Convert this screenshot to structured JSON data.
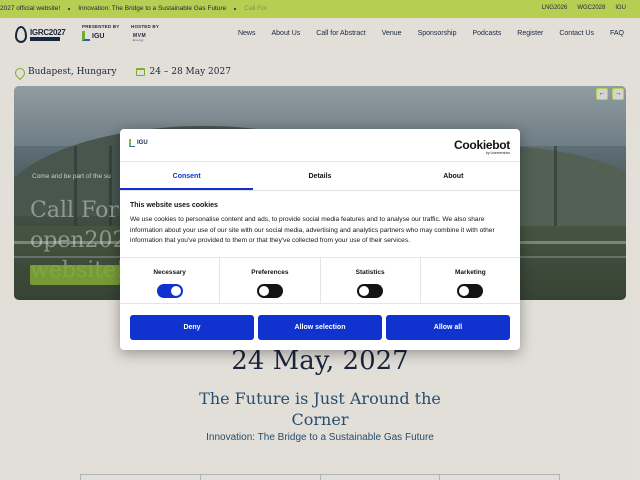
{
  "ticker": {
    "items": [
      "2027 official website!",
      "Innovation: The Bridge to a Sustainable Gas Future",
      "Call For"
    ],
    "sister_links": [
      "LNG2026",
      "WGC2028",
      "IGU"
    ]
  },
  "header": {
    "logo_text": "IGRC2027",
    "presented_by": "PRESENTED BY",
    "igu_logo": "IGU",
    "hosted_by": "HOSTED BY",
    "mvm_logo": "MVM",
    "mvm_sub": "Energy",
    "nav": [
      "News",
      "About Us",
      "Call for Abstract",
      "Venue",
      "Sponsorship",
      "Podcasts",
      "Register",
      "Contact Us",
      "FAQ"
    ]
  },
  "event": {
    "location": "Budapest, Hungary",
    "dates": "24 – 28 May 2027"
  },
  "hero": {
    "subtitle": "Come and be part of the su",
    "title": "Call For A open202 website!"
  },
  "main": {
    "date_big": "24 May, 2027",
    "future_heading": "The Future is Just Around the Corner",
    "tagline": "Innovation: The Bridge to a Sustainable Gas Future"
  },
  "cookie_dialog": {
    "brand_logo": "IGU",
    "provider": "Cookiebot",
    "provider_sub": "by Usercentrics",
    "tabs": [
      {
        "label": "Consent",
        "active": true
      },
      {
        "label": "Details",
        "active": false
      },
      {
        "label": "About",
        "active": false
      }
    ],
    "title": "This website uses cookies",
    "text": "We use cookies to personalise content and ads, to provide social media features and to analyse our traffic. We also share information about your use of our site with our social media, advertising and analytics partners who may combine it with other information that you've provided to them or that they've collected from your use of their services.",
    "toggles": [
      {
        "label": "Necessary",
        "on": true
      },
      {
        "label": "Preferences",
        "on": false
      },
      {
        "label": "Statistics",
        "on": false
      },
      {
        "label": "Marketing",
        "on": false
      }
    ],
    "buttons": {
      "deny": "Deny",
      "allow_selection": "Allow selection",
      "allow_all": "Allow all"
    },
    "accent_color": "#1032cf"
  },
  "colors": {
    "ticker_bg": "#c8e05a",
    "page_bg": "#f6f2ec",
    "text_navy": "#1b2a44",
    "accent_green": "#8cb83b"
  }
}
